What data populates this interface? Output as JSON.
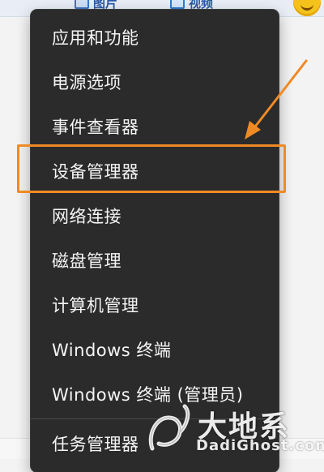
{
  "background": {
    "tabs": [
      {
        "label": "图片",
        "icon": "image-icon"
      },
      {
        "label": "视频",
        "icon": "video-icon"
      }
    ],
    "avatar_icon": "smiley-icon"
  },
  "menu": {
    "items": [
      {
        "label": "应用和功能"
      },
      {
        "label": "电源选项"
      },
      {
        "label": "事件查看器"
      },
      {
        "label": "设备管理器",
        "highlighted": true
      },
      {
        "label": "网络连接"
      },
      {
        "label": "磁盘管理"
      },
      {
        "label": "计算机管理"
      },
      {
        "label": "Windows 终端"
      },
      {
        "label": "Windows 终端 (管理员)"
      },
      {
        "label": "任务管理器"
      }
    ]
  },
  "annotation": {
    "color": "#f08a24",
    "target": "设备管理器"
  },
  "watermark": {
    "title": "大地系",
    "subtitle": "DadiGhost.com"
  }
}
